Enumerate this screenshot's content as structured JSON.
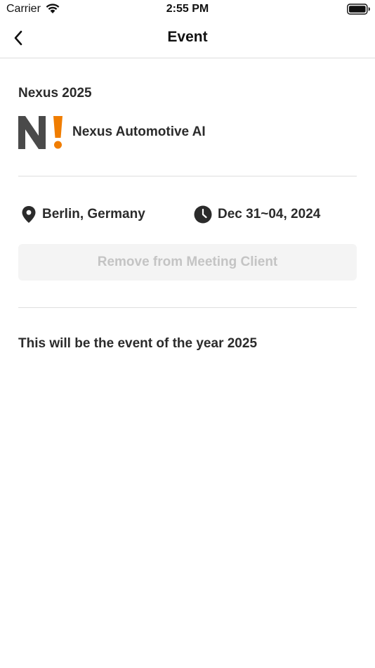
{
  "status_bar": {
    "carrier": "Carrier",
    "time": "2:55 PM"
  },
  "nav": {
    "title": "Event",
    "back_icon": "chevron-left-icon"
  },
  "event": {
    "name": "Nexus 2025",
    "company": "Nexus Automotive AI",
    "logo_text": "N!",
    "logo_colors": {
      "letter": "#4a4a4a",
      "exclamation": "#f07d00"
    },
    "location": "Berlin, Germany",
    "date": "Dec 31~04, 2024",
    "remove_button_label": "Remove from Meeting Client",
    "description": "This will be the event of the year 2025"
  },
  "colors": {
    "text": "#2b2b2b",
    "divider": "#dedede",
    "button_bg": "#f4f4f4",
    "button_text": "#c4c4c4"
  }
}
